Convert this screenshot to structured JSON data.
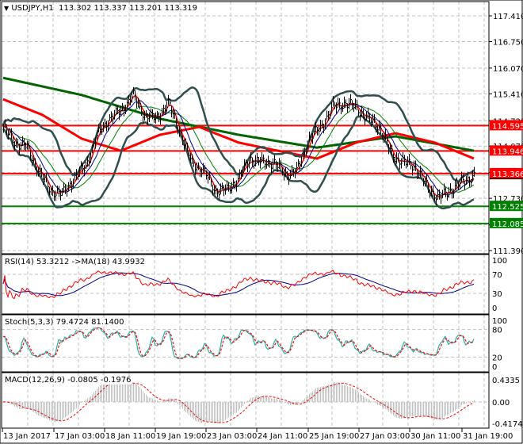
{
  "header": {
    "symbol": "USDJPY,H1",
    "ohlc": "113.302 113.337 113.201 113.319",
    "menu_icon": "triangle-down-icon"
  },
  "panels": {
    "rsi_label": "RSI(14) 53.3212  ->MA(18) 43.9932",
    "stoch_label": "Stoch(5,3,3) 79.4724 81.1400",
    "macd_label": "MACD(12,26,9) -0.0805 -0.1976"
  },
  "colors": {
    "bars": "#000000",
    "ma_fast": "#ff0000",
    "ma_mid": "#00008b",
    "ma_slow": "#008000",
    "bands": "#2f4f4f",
    "ma_100": "#ff0000",
    "ma_200": "#006400",
    "level_resistance": "#ff0000",
    "level_support": "#008000",
    "rsi": "#ff0000",
    "rsi_ma": "#00008b",
    "stoch_main": "#20b2aa",
    "stoch_signal": "#ff0000",
    "macd_hist": "#c0c0c0",
    "macd_signal": "#ff0000",
    "grid": "#c0c0c0"
  },
  "chart_data": [
    {
      "type": "line",
      "title": "USDJPY,H1",
      "price_axis_ticks": [
        "117.410",
        "116.750",
        "116.070",
        "115.410",
        "114.720",
        "114.070",
        "113.390",
        "112.730",
        "112.050",
        "111.390"
      ],
      "ylim": [
        111.39,
        117.41
      ],
      "time_axis_ticks": [
        "13 Jan 2017",
        "17 Jan 03:00",
        "18 Jan 11:00",
        "19 Jan 19:00",
        "23 Jan 03:00",
        "24 Jan 11:00",
        "25 Jan 19:00",
        "27 Jan 03:00",
        "30 Jan 11:00",
        "31 Jan 19:00"
      ],
      "grid": true,
      "close_path": [
        114.56,
        114.16,
        114.05,
        113.44,
        112.94,
        112.83,
        113.24,
        113.55,
        114.36,
        114.77,
        114.97,
        115.38,
        114.87,
        114.77,
        115.17,
        114.46,
        113.65,
        113.44,
        112.94,
        112.94,
        113.24,
        113.75,
        113.65,
        113.65,
        113.34,
        113.44,
        114.26,
        114.56,
        115.07,
        115.17,
        115.07,
        114.77,
        114.56,
        113.85,
        113.65,
        113.55,
        113.04,
        112.73,
        112.94,
        113.14,
        113.32
      ],
      "ma_100_path": [
        115.27,
        114.87,
        114.26,
        113.95,
        114.36,
        114.56,
        114.16,
        113.95,
        113.75,
        114.16,
        114.4,
        114.16,
        113.75
      ],
      "ma_200_path": [
        115.82,
        115.38,
        114.77,
        114.36,
        114.03,
        114.32,
        113.95
      ],
      "levels": [
        {
          "price": "114.595",
          "kind": "resistance"
        },
        {
          "price": "113.946",
          "kind": "resistance"
        },
        {
          "price": "113.366",
          "kind": "resistance"
        },
        {
          "price": "112.525",
          "kind": "support"
        },
        {
          "price": "112.085",
          "kind": "support"
        }
      ],
      "current_price": "113.319"
    },
    {
      "type": "line",
      "title": "RSI(14)",
      "ylim": [
        0,
        100
      ],
      "ticks": [
        "100",
        "70",
        "30",
        "0"
      ],
      "tick_values": [
        100,
        70,
        30,
        0
      ],
      "last_values": {
        "rsi": 53.3212,
        "ma": 43.9932
      }
    },
    {
      "type": "line",
      "title": "Stoch(5,3,3)",
      "ylim": [
        0,
        100
      ],
      "ticks": [
        "100",
        "80",
        "20",
        "0"
      ],
      "tick_values": [
        100,
        80,
        20,
        0
      ],
      "last_values": {
        "main": 79.4724,
        "signal": 81.14
      }
    },
    {
      "type": "bar",
      "title": "MACD(12,26,9)",
      "ylim": [
        -0.4174,
        0.4335
      ],
      "ticks": [
        "0.4335",
        "0.00",
        "-0.4174"
      ],
      "tick_values": [
        0.4335,
        0,
        -0.4174
      ],
      "last_values": {
        "macd": -0.0805,
        "signal": -0.1976
      }
    }
  ]
}
